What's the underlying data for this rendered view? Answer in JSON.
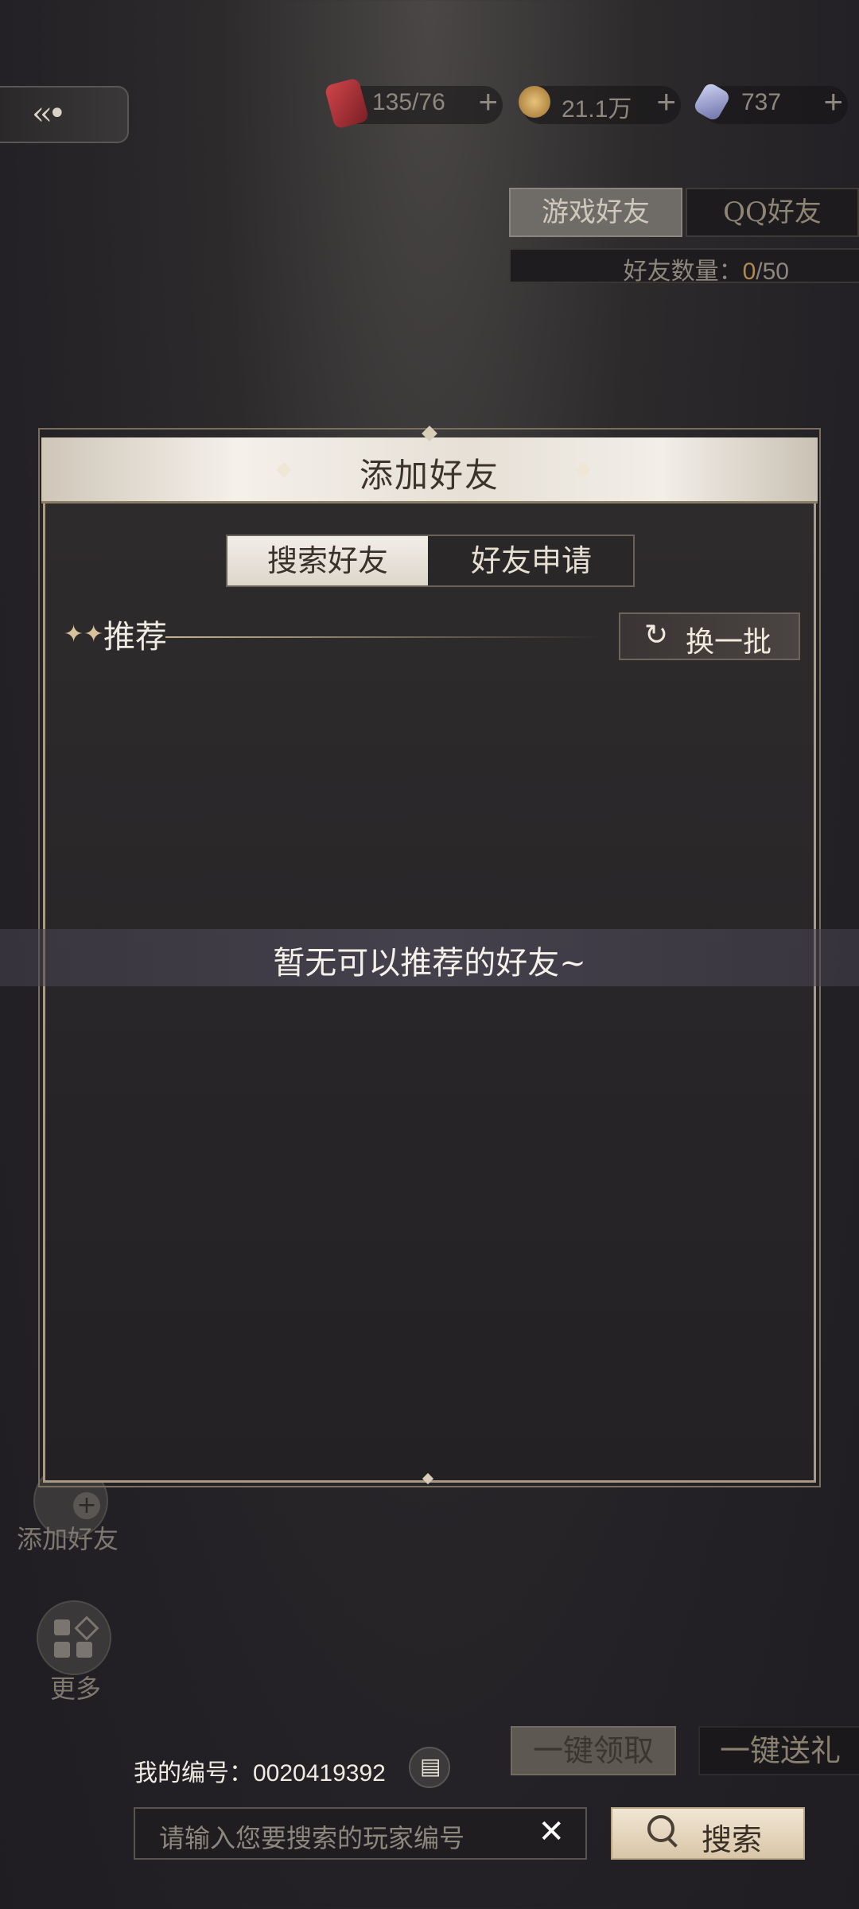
{
  "topbar": {
    "back_icon": "back-arrow-icon",
    "resources": [
      {
        "icon": "stamina-potion-icon",
        "value": "135/76",
        "plus": "+"
      },
      {
        "icon": "gold-coin-icon",
        "value": "21.1万",
        "plus": "+"
      },
      {
        "icon": "crystal-gem-icon",
        "value": "737",
        "plus": "+"
      }
    ]
  },
  "friend_tabs": {
    "game": "游戏好友",
    "qq": "QQ好友",
    "count_label": "好友数量：",
    "count_current": "0",
    "count_max": "/50"
  },
  "side": {
    "add_friend_label": "添加好友",
    "more_label": "更多"
  },
  "bottom": {
    "claim_all": "一键领取",
    "gift_all": "一键送礼"
  },
  "dialog": {
    "title": "添加好友",
    "tabs": [
      "搜索好友",
      "好友申请"
    ],
    "recommend_title": "推荐",
    "refresh_label": "换一批",
    "empty_message": "暂无可以推荐的好友~",
    "my_id_label": "我的编号：",
    "my_id_value": "0020419392",
    "search_placeholder": "请输入您要搜索的玩家编号",
    "search_button": "搜索"
  },
  "colors": {
    "accent_gold": "#b28a4c",
    "header_light": "#f4f0ea",
    "panel_dark": "#2a2728"
  }
}
